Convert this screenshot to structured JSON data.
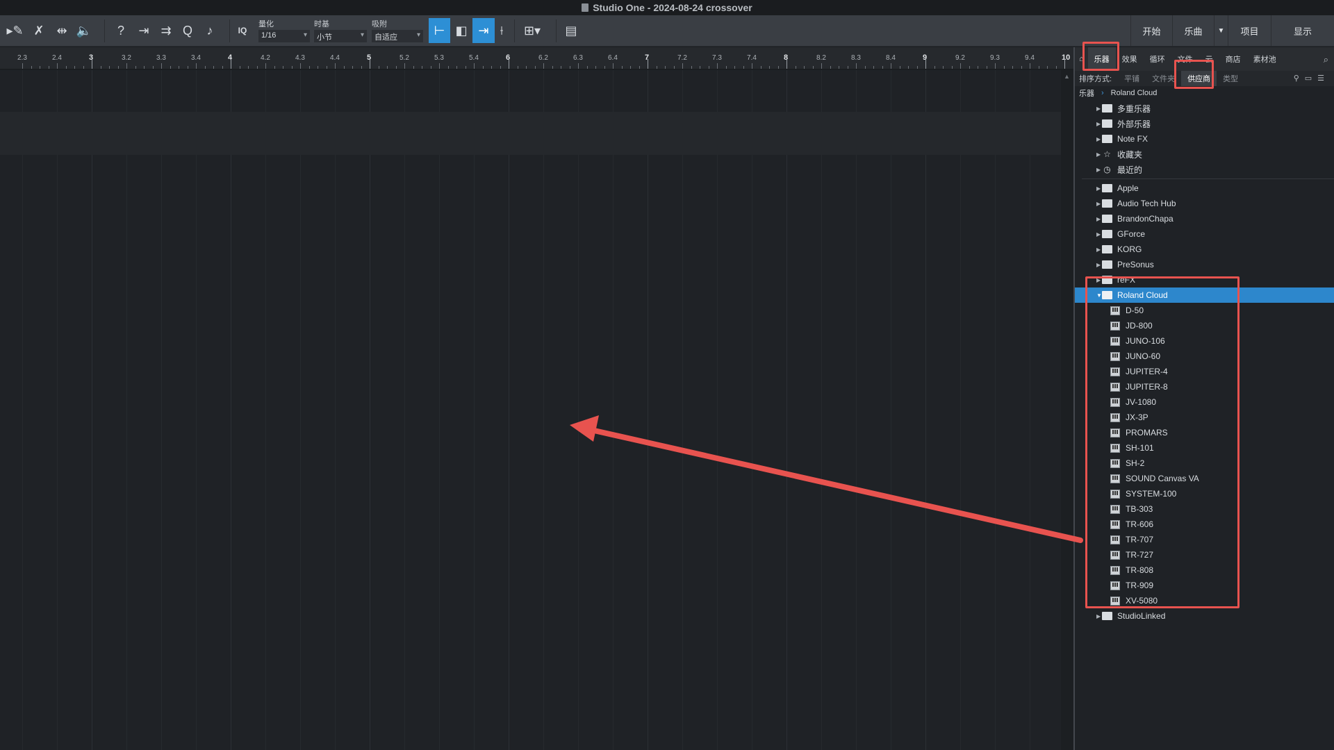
{
  "window": {
    "title": "Studio One - 2024-08-24 crossover"
  },
  "toolbar": {
    "quantize": {
      "label": "量化",
      "value": "1/16"
    },
    "timebase": {
      "label": "时基",
      "value": "小节"
    },
    "snap": {
      "label": "吸附",
      "value": "自适应"
    },
    "iq_label": "IQ",
    "help_glyph": "?",
    "q_glyph": "Q",
    "right_buttons": [
      "开始",
      "乐曲",
      "项目",
      "显示"
    ]
  },
  "ruler": {
    "labels": [
      "2.3",
      "2.4",
      "3",
      "3.2",
      "3.3",
      "3.4",
      "4",
      "4.2",
      "4.3",
      "4.4",
      "5",
      "5.2",
      "5.3",
      "5.4",
      "6",
      "6.2",
      "6.3",
      "6.4",
      "7",
      "7.2",
      "7.3",
      "7.4",
      "8",
      "8.2",
      "8.3",
      "8.4",
      "9",
      "9.2",
      "9.3",
      "9.4",
      "10"
    ]
  },
  "browser": {
    "tabs": [
      "乐器",
      "效果",
      "循环",
      "文件",
      "云",
      "商店",
      "素材池"
    ],
    "selected_tab": "乐器",
    "sort": {
      "label": "排序方式:",
      "options": [
        "平铺",
        "文件夹",
        "供应商",
        "类型"
      ],
      "selected": "供应商"
    },
    "breadcrumb": {
      "root": "乐器",
      "current": "Roland Cloud"
    },
    "special_items": [
      {
        "label": "多重乐器",
        "icon": "multi-instrument-icon"
      },
      {
        "label": "外部乐器",
        "icon": "external-instrument-icon"
      },
      {
        "label": "Note FX",
        "icon": "folder-icon"
      },
      {
        "label": "收藏夹",
        "icon": "star-icon"
      },
      {
        "label": "最近的",
        "icon": "clock-icon"
      }
    ],
    "vendors": [
      {
        "label": "Apple",
        "icon": "folder-icon"
      },
      {
        "label": "Audio Tech Hub",
        "icon": "folder-icon"
      },
      {
        "label": "BrandonChapa",
        "icon": "folder-icon"
      },
      {
        "label": "GForce",
        "icon": "folder-icon"
      },
      {
        "label": "KORG",
        "icon": "folder-icon"
      },
      {
        "label": "PreSonus",
        "icon": "presonus-icon"
      },
      {
        "label": "reFX",
        "icon": "folder-icon"
      }
    ],
    "expanded_vendor": {
      "label": "Roland Cloud",
      "children": [
        "D-50",
        "JD-800",
        "JUNO-106",
        "JUNO-60",
        "JUPITER-4",
        "JUPITER-8",
        "JV-1080",
        "JX-3P",
        "PROMARS",
        "SH-101",
        "SH-2",
        "SOUND Canvas VA",
        "SYSTEM-100",
        "TB-303",
        "TR-606",
        "TR-707",
        "TR-727",
        "TR-808",
        "TR-909",
        "XV-5080"
      ]
    },
    "after_vendor": {
      "label": "StudioLinked",
      "icon": "folder-icon"
    }
  },
  "colors": {
    "accent": "#2d87cc",
    "highlight": "#e8534f",
    "background": "#1f2226"
  }
}
